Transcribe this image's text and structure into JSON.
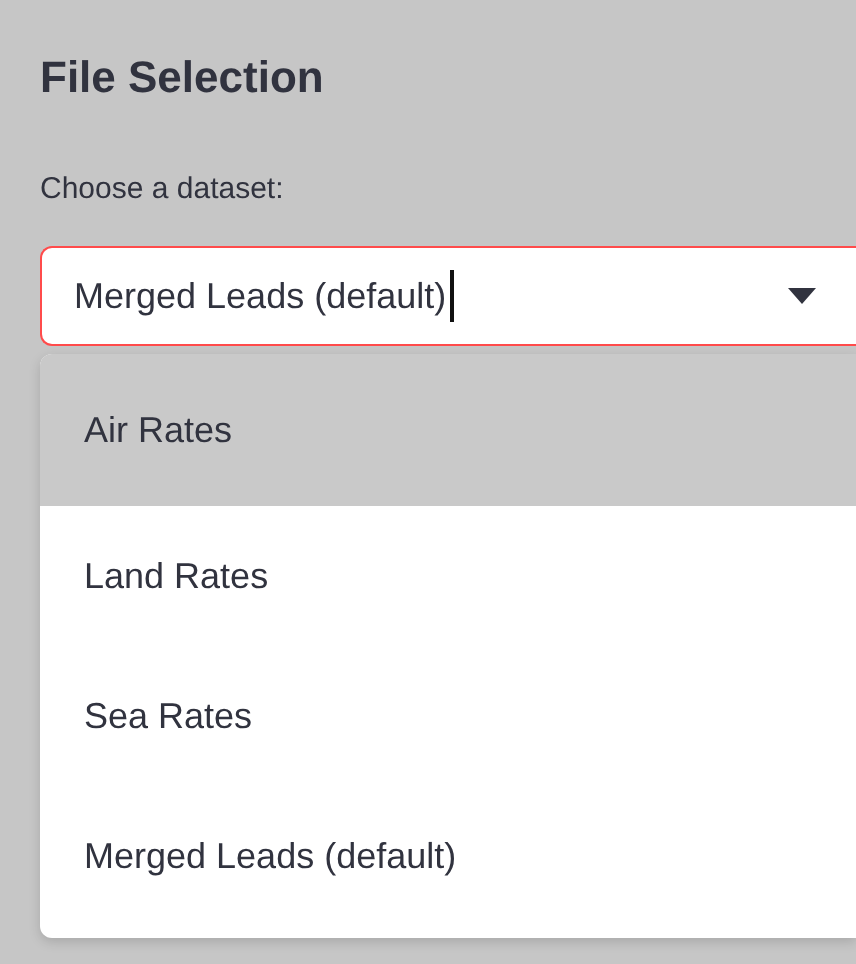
{
  "section": {
    "title": "File Selection"
  },
  "select": {
    "label": "Choose a dataset:",
    "value": "Merged Leads (default)",
    "focused": true,
    "expanded": true
  },
  "options": [
    {
      "label": "Air Rates",
      "highlighted": true
    },
    {
      "label": "Land Rates",
      "highlighted": false
    },
    {
      "label": "Sea Rates",
      "highlighted": false
    },
    {
      "label": "Merged Leads (default)",
      "highlighted": false
    }
  ]
}
